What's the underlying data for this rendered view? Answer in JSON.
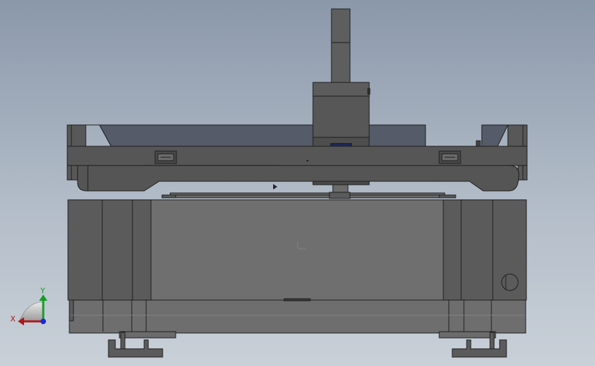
{
  "view": {
    "background_top": "#8b98aa",
    "background_bottom": "#c9d0d8"
  },
  "model": {
    "body_color": "#5a5a5a",
    "gantry_color": "#545454",
    "bed_color": "#6e6e6e",
    "window_color": "#555b68",
    "edge_color": "#1c1c1c"
  },
  "triad": {
    "x_label": "X",
    "y_label": "Y",
    "x_color": "#b01818",
    "y_color": "#10a020",
    "z_color": "#1a2ad8",
    "icon": "coordinate-triad-icon"
  }
}
